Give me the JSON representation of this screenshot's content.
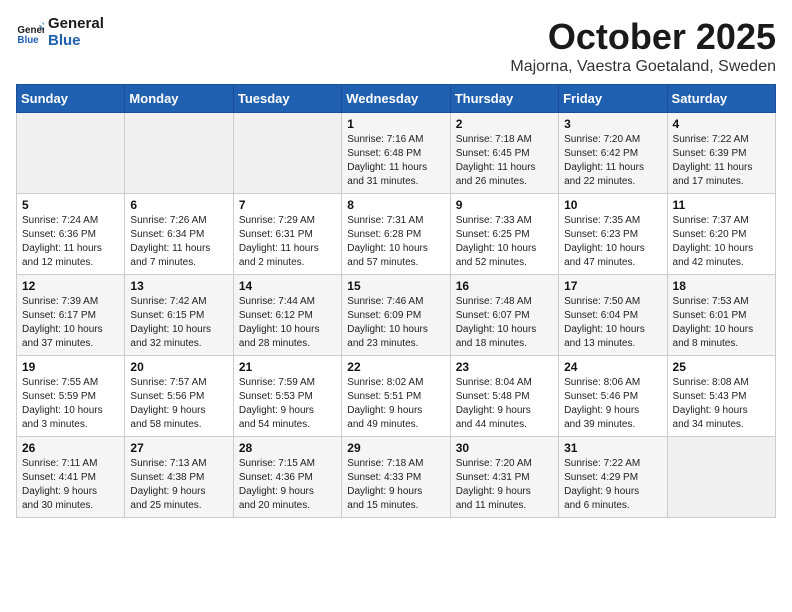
{
  "header": {
    "logo_line1": "General",
    "logo_line2": "Blue",
    "title": "October 2025",
    "subtitle": "Majorna, Vaestra Goetaland, Sweden"
  },
  "days_of_week": [
    "Sunday",
    "Monday",
    "Tuesday",
    "Wednesday",
    "Thursday",
    "Friday",
    "Saturday"
  ],
  "weeks": [
    [
      {
        "day": "",
        "info": ""
      },
      {
        "day": "",
        "info": ""
      },
      {
        "day": "",
        "info": ""
      },
      {
        "day": "1",
        "info": "Sunrise: 7:16 AM\nSunset: 6:48 PM\nDaylight: 11 hours\nand 31 minutes."
      },
      {
        "day": "2",
        "info": "Sunrise: 7:18 AM\nSunset: 6:45 PM\nDaylight: 11 hours\nand 26 minutes."
      },
      {
        "day": "3",
        "info": "Sunrise: 7:20 AM\nSunset: 6:42 PM\nDaylight: 11 hours\nand 22 minutes."
      },
      {
        "day": "4",
        "info": "Sunrise: 7:22 AM\nSunset: 6:39 PM\nDaylight: 11 hours\nand 17 minutes."
      }
    ],
    [
      {
        "day": "5",
        "info": "Sunrise: 7:24 AM\nSunset: 6:36 PM\nDaylight: 11 hours\nand 12 minutes."
      },
      {
        "day": "6",
        "info": "Sunrise: 7:26 AM\nSunset: 6:34 PM\nDaylight: 11 hours\nand 7 minutes."
      },
      {
        "day": "7",
        "info": "Sunrise: 7:29 AM\nSunset: 6:31 PM\nDaylight: 11 hours\nand 2 minutes."
      },
      {
        "day": "8",
        "info": "Sunrise: 7:31 AM\nSunset: 6:28 PM\nDaylight: 10 hours\nand 57 minutes."
      },
      {
        "day": "9",
        "info": "Sunrise: 7:33 AM\nSunset: 6:25 PM\nDaylight: 10 hours\nand 52 minutes."
      },
      {
        "day": "10",
        "info": "Sunrise: 7:35 AM\nSunset: 6:23 PM\nDaylight: 10 hours\nand 47 minutes."
      },
      {
        "day": "11",
        "info": "Sunrise: 7:37 AM\nSunset: 6:20 PM\nDaylight: 10 hours\nand 42 minutes."
      }
    ],
    [
      {
        "day": "12",
        "info": "Sunrise: 7:39 AM\nSunset: 6:17 PM\nDaylight: 10 hours\nand 37 minutes."
      },
      {
        "day": "13",
        "info": "Sunrise: 7:42 AM\nSunset: 6:15 PM\nDaylight: 10 hours\nand 32 minutes."
      },
      {
        "day": "14",
        "info": "Sunrise: 7:44 AM\nSunset: 6:12 PM\nDaylight: 10 hours\nand 28 minutes."
      },
      {
        "day": "15",
        "info": "Sunrise: 7:46 AM\nSunset: 6:09 PM\nDaylight: 10 hours\nand 23 minutes."
      },
      {
        "day": "16",
        "info": "Sunrise: 7:48 AM\nSunset: 6:07 PM\nDaylight: 10 hours\nand 18 minutes."
      },
      {
        "day": "17",
        "info": "Sunrise: 7:50 AM\nSunset: 6:04 PM\nDaylight: 10 hours\nand 13 minutes."
      },
      {
        "day": "18",
        "info": "Sunrise: 7:53 AM\nSunset: 6:01 PM\nDaylight: 10 hours\nand 8 minutes."
      }
    ],
    [
      {
        "day": "19",
        "info": "Sunrise: 7:55 AM\nSunset: 5:59 PM\nDaylight: 10 hours\nand 3 minutes."
      },
      {
        "day": "20",
        "info": "Sunrise: 7:57 AM\nSunset: 5:56 PM\nDaylight: 9 hours\nand 58 minutes."
      },
      {
        "day": "21",
        "info": "Sunrise: 7:59 AM\nSunset: 5:53 PM\nDaylight: 9 hours\nand 54 minutes."
      },
      {
        "day": "22",
        "info": "Sunrise: 8:02 AM\nSunset: 5:51 PM\nDaylight: 9 hours\nand 49 minutes."
      },
      {
        "day": "23",
        "info": "Sunrise: 8:04 AM\nSunset: 5:48 PM\nDaylight: 9 hours\nand 44 minutes."
      },
      {
        "day": "24",
        "info": "Sunrise: 8:06 AM\nSunset: 5:46 PM\nDaylight: 9 hours\nand 39 minutes."
      },
      {
        "day": "25",
        "info": "Sunrise: 8:08 AM\nSunset: 5:43 PM\nDaylight: 9 hours\nand 34 minutes."
      }
    ],
    [
      {
        "day": "26",
        "info": "Sunrise: 7:11 AM\nSunset: 4:41 PM\nDaylight: 9 hours\nand 30 minutes."
      },
      {
        "day": "27",
        "info": "Sunrise: 7:13 AM\nSunset: 4:38 PM\nDaylight: 9 hours\nand 25 minutes."
      },
      {
        "day": "28",
        "info": "Sunrise: 7:15 AM\nSunset: 4:36 PM\nDaylight: 9 hours\nand 20 minutes."
      },
      {
        "day": "29",
        "info": "Sunrise: 7:18 AM\nSunset: 4:33 PM\nDaylight: 9 hours\nand 15 minutes."
      },
      {
        "day": "30",
        "info": "Sunrise: 7:20 AM\nSunset: 4:31 PM\nDaylight: 9 hours\nand 11 minutes."
      },
      {
        "day": "31",
        "info": "Sunrise: 7:22 AM\nSunset: 4:29 PM\nDaylight: 9 hours\nand 6 minutes."
      },
      {
        "day": "",
        "info": ""
      }
    ]
  ]
}
